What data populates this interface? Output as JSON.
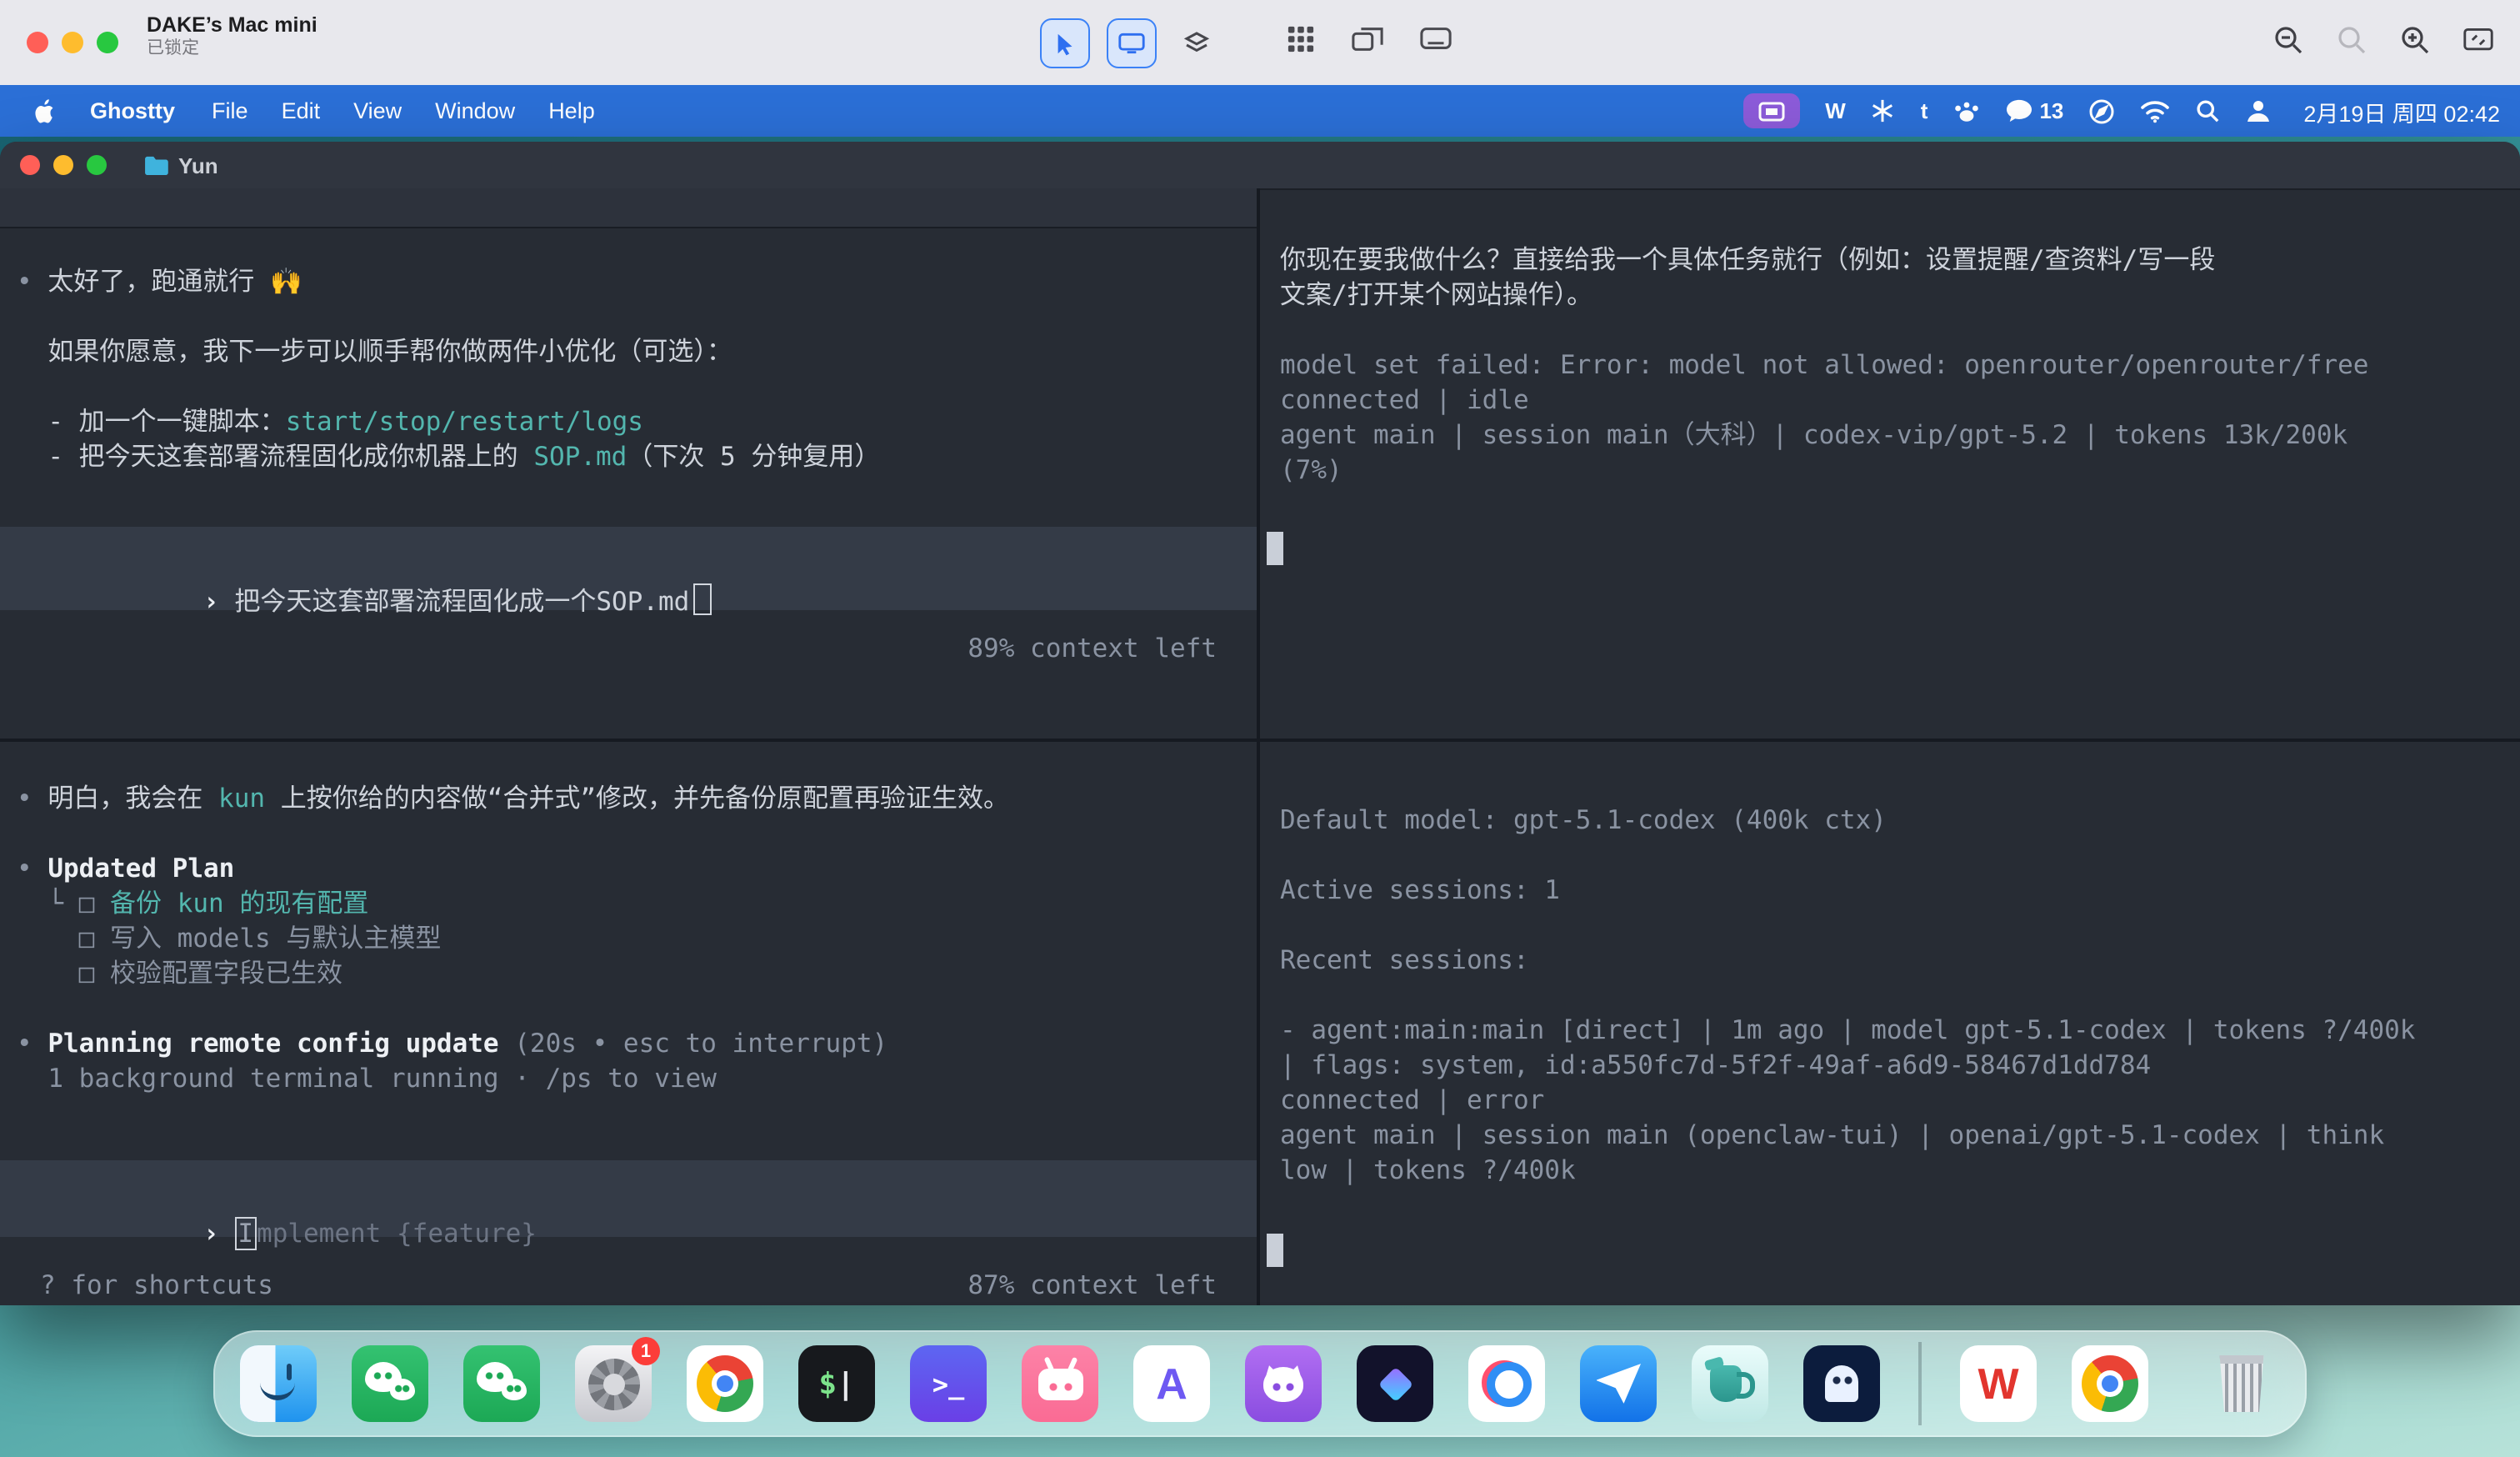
{
  "remote_bar": {
    "title": "DAKE’s Mac mini",
    "subtitle": "已锁定",
    "icons": [
      "cursor-tool-icon",
      "screen-control-icon",
      "layers-icon",
      "app-grid-icon",
      "windows-icon",
      "display-icon",
      "zoom-out-icon",
      "zoom-reset-icon",
      "zoom-in-icon",
      "fit-screen-icon"
    ]
  },
  "menu_bar": {
    "app": "Ghostty",
    "items": [
      "File",
      "Edit",
      "View",
      "Window",
      "Help"
    ],
    "status_icons": [
      "screen-sharing-pill-icon",
      "wps-icon",
      "snowflake-icon",
      "t-app-icon",
      "paw-icon",
      "wechat-icon",
      "compass-icon",
      "wifi-icon",
      "search-icon",
      "user-switch-icon"
    ],
    "wps_glyph": "W",
    "t_glyph": "t",
    "wechat_badge": "13",
    "clock": "2月19日 周四 02:42"
  },
  "window": {
    "title": "Yun"
  },
  "panes": {
    "left_top": {
      "lines": [
        {
          "seg": [
            {
              "t": "• ",
              "c": "dim"
            },
            {
              "t": "太好了，跑通就行 🙌",
              "c": "fg"
            }
          ]
        },
        {
          "blank": true
        },
        {
          "seg": [
            {
              "t": "  如果你愿意，我下一步可以顺手帮你做两件小优化（可选）：",
              "c": "fg"
            }
          ]
        },
        {
          "blank": true
        },
        {
          "seg": [
            {
              "t": "  - 加一个一键脚本：",
              "c": "fg"
            },
            {
              "t": "start/stop/restart/logs",
              "c": "teal"
            }
          ]
        },
        {
          "seg": [
            {
              "t": "  - 把今天这套部署流程固化成你机器上的 ",
              "c": "fg"
            },
            {
              "t": "SOP.md",
              "c": "teal"
            },
            {
              "t": "（下次 5 分钟复用）",
              "c": "fg"
            }
          ]
        }
      ],
      "input": {
        "prompt": "›",
        "text": "把今天这套部署流程固化成一个SOP.md"
      },
      "context": "89% context left"
    },
    "left_bottom": {
      "lines": [
        {
          "seg": [
            {
              "t": "• ",
              "c": "dim"
            },
            {
              "t": "明白，我会在 ",
              "c": "fg"
            },
            {
              "t": "kun",
              "c": "teal"
            },
            {
              "t": " 上按你给的内容做“合并式”修改，并先备份原配置再验证生效。",
              "c": "fg"
            }
          ]
        },
        {
          "blank": true
        },
        {
          "seg": [
            {
              "t": "• ",
              "c": "dim"
            },
            {
              "t": "Updated Plan",
              "c": "bold"
            }
          ]
        },
        {
          "seg": [
            {
              "t": "  └ ",
              "c": "dim"
            },
            {
              "t": "□",
              "c": "dim"
            },
            {
              "t": " 备份 kun 的现有配置",
              "c": "teal"
            }
          ]
        },
        {
          "seg": [
            {
              "t": "    ",
              "c": "dim"
            },
            {
              "t": "□",
              "c": "dim"
            },
            {
              "t": " 写入 models 与默认主模型",
              "c": "dim"
            }
          ]
        },
        {
          "seg": [
            {
              "t": "    ",
              "c": "dim"
            },
            {
              "t": "□",
              "c": "dim"
            },
            {
              "t": " 校验配置字段已生效",
              "c": "dim"
            }
          ]
        },
        {
          "blank": true
        },
        {
          "seg": [
            {
              "t": "• ",
              "c": "dim"
            },
            {
              "t": "Planning remote config update",
              "c": "bold"
            },
            {
              "t": " (20s • esc to interrupt)",
              "c": "dim"
            }
          ]
        },
        {
          "seg": [
            {
              "t": "  1 background terminal running · /ps to view",
              "c": "dim"
            }
          ]
        }
      ],
      "input": {
        "prompt": "›",
        "cursor_char": "I",
        "placeholder_rest": "mplement {feature}"
      },
      "shortcuts": "? for shortcuts",
      "context": "87% context left"
    },
    "right_top": {
      "lines": [
        {
          "seg": [
            {
              "t": "你现在要我做什么？直接给我一个具体任务就行（例如：设置提醒/查资料/写一段",
              "c": "fg"
            }
          ]
        },
        {
          "seg": [
            {
              "t": "文案/打开某个网站操作）。",
              "c": "fg"
            }
          ]
        },
        {
          "blank": true
        },
        {
          "seg": [
            {
              "t": "model set failed: Error: model not allowed: openrouter/openrouter/free",
              "c": "dim"
            }
          ]
        },
        {
          "seg": [
            {
              "t": "connected | idle",
              "c": "dim"
            }
          ]
        },
        {
          "seg": [
            {
              "t": "agent main | session main（大科）| codex-vip/gpt-5.2 | tokens 13k/200k",
              "c": "dim"
            }
          ]
        },
        {
          "seg": [
            {
              "t": "(7%)",
              "c": "dim"
            }
          ]
        }
      ]
    },
    "right_bottom": {
      "lines": [
        {
          "seg": [
            {
              "t": "Default model: gpt-5.1-codex (400k ctx)",
              "c": "dim"
            }
          ]
        },
        {
          "blank": true
        },
        {
          "seg": [
            {
              "t": "Active sessions: 1",
              "c": "dim"
            }
          ]
        },
        {
          "blank": true
        },
        {
          "seg": [
            {
              "t": "Recent sessions:",
              "c": "dim"
            }
          ]
        },
        {
          "blank": true
        },
        {
          "seg": [
            {
              "t": "- agent:main:main [direct] | 1m ago | model gpt-5.1-codex | tokens ?/400k",
              "c": "dim"
            }
          ]
        },
        {
          "seg": [
            {
              "t": "| flags: system, id:a550fc7d-5f2f-49af-a6d9-58467d1dd784",
              "c": "dim"
            }
          ]
        },
        {
          "seg": [
            {
              "t": "connected | error",
              "c": "dim"
            }
          ]
        },
        {
          "seg": [
            {
              "t": "agent main | session main (openclaw-tui) | openai/gpt-5.1-codex | think",
              "c": "dim"
            }
          ]
        },
        {
          "seg": [
            {
              "t": "low | tokens ?/400k",
              "c": "dim"
            }
          ]
        }
      ]
    }
  },
  "dock": {
    "items": [
      "finder",
      "wechat",
      "wechat-2",
      "system-settings",
      "chrome",
      "terminal",
      "warp-terminal",
      "bilibili",
      "arc-browser",
      "cat-app",
      "gem-app",
      "circles-app",
      "paper-plane-app",
      "jug-app",
      "ghostty",
      "wps-office",
      "chrome-2",
      "trash"
    ],
    "settings_badge": "1",
    "terminal_dollar": "$",
    "terminal_cursor": "|",
    "warp_glyph": ">_",
    "arc_glyph": "A",
    "wps_glyph": "W"
  }
}
